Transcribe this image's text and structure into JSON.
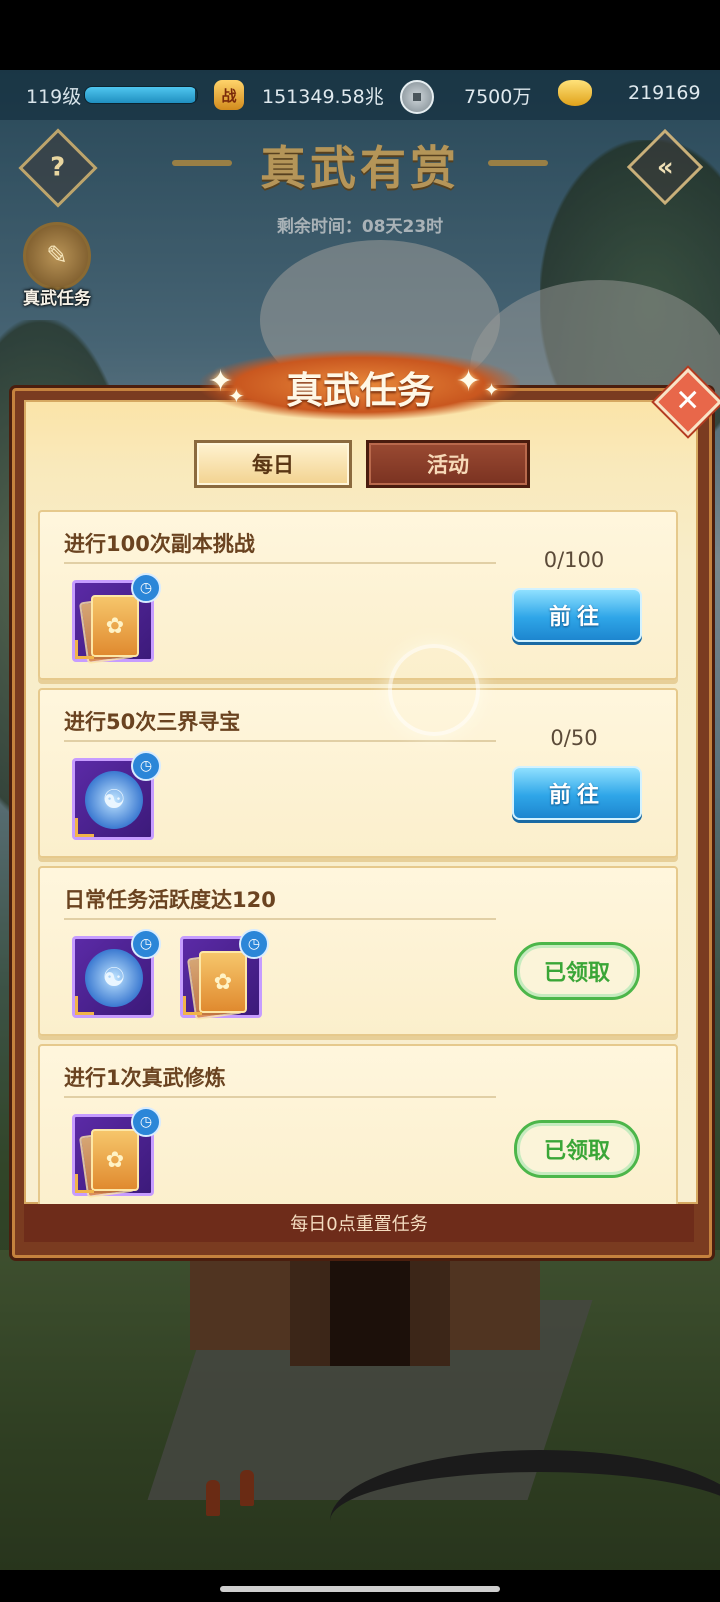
{
  "hud": {
    "level": "119级",
    "xp_fraction": 0.98,
    "power_icon_text": "战",
    "power": "151349.58兆",
    "coin": "7500万",
    "ingot": "219169"
  },
  "header": {
    "title": "真武有赏",
    "remaining": "剩余时间：08天23时",
    "help_icon": "?",
    "back_icon": "«",
    "side_task_label": "真武任务"
  },
  "modal": {
    "title": "真武任务",
    "close_icon": "✕",
    "tabs": [
      {
        "label": "每日",
        "active": true
      },
      {
        "label": "活动",
        "active": false
      }
    ],
    "footer": "每日0点重置任务"
  },
  "tasks": [
    {
      "title": "进行100次副本挑战",
      "progress": "0/100",
      "action": "前往",
      "status": "go",
      "rewards": [
        "lotus-card"
      ]
    },
    {
      "title": "进行50次三界寻宝",
      "progress": "0/50",
      "action": "前往",
      "status": "go",
      "rewards": [
        "spirit-orb"
      ]
    },
    {
      "title": "日常任务活跃度达120",
      "progress": "",
      "action": "已领取",
      "status": "claimed",
      "rewards": [
        "spirit-orb",
        "lotus-card"
      ]
    },
    {
      "title": "进行1次真武修炼",
      "progress": "",
      "action": "已领取",
      "status": "claimed",
      "rewards": [
        "lotus-card"
      ]
    }
  ],
  "colors": {
    "go_button": "#2fa6e8",
    "claimed_border": "#4cb64a",
    "modal_frame": "#7a3b20"
  }
}
